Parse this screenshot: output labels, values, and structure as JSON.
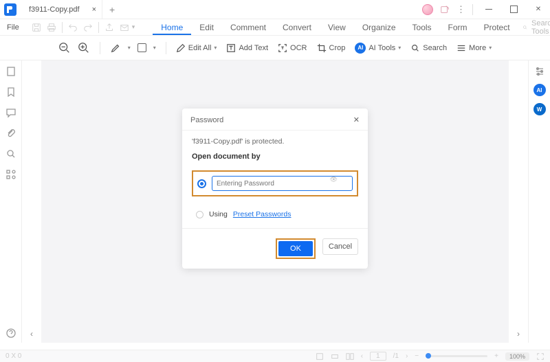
{
  "title_bar": {
    "tab": "f3911-Copy.pdf"
  },
  "menu": {
    "file": "File",
    "tabs": [
      "Home",
      "Edit",
      "Comment",
      "Convert",
      "View",
      "Organize",
      "Tools",
      "Form",
      "Protect"
    ],
    "active_index": 0,
    "search_placeholder": "Search Tools"
  },
  "toolbar": {
    "edit_all": "Edit All",
    "add_text": "Add Text",
    "ocr": "OCR",
    "crop": "Crop",
    "ai_tools_badge": "AI",
    "ai_tools": "AI Tools",
    "search": "Search",
    "more": "More"
  },
  "dialog": {
    "title": "Password",
    "message": "'f3911-Copy.pdf' is protected.",
    "open_label": "Open document by",
    "password_placeholder": "Entering Password",
    "using_label": "Using",
    "preset_link": "Preset Passwords",
    "ok": "OK",
    "cancel": "Cancel"
  },
  "bottom": {
    "dim": "0 X 0",
    "page": "1",
    "of": "/1",
    "zoom": "100%"
  }
}
